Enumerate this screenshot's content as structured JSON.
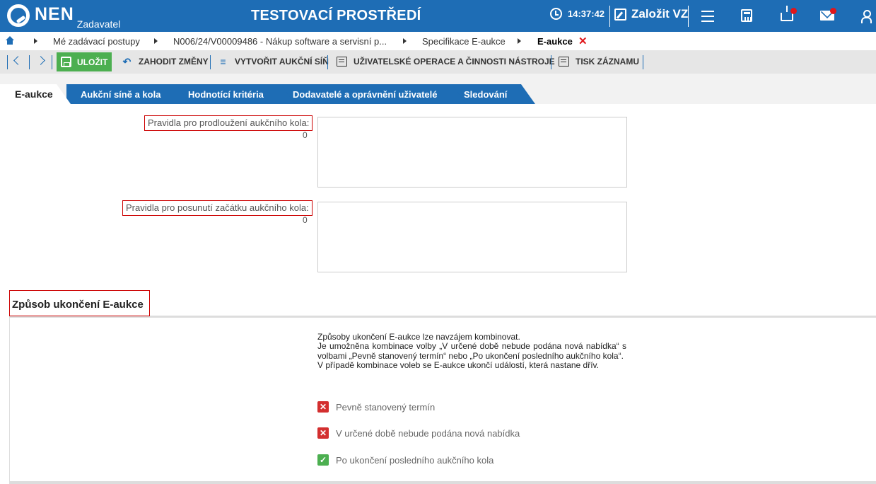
{
  "header": {
    "logo_text": "NEN",
    "logo_sub": "Zadavatel",
    "env_title": "TESTOVACÍ PROSTŘEDÍ",
    "time": "14:37:42",
    "create_label": "Založit VZ"
  },
  "breadcrumb": {
    "items": [
      "Mé zadávací postupy",
      "N006/24/V00009486 - Nákup software a servisní p...",
      "Specifikace E-aukce",
      "E-aukce"
    ]
  },
  "toolbar": {
    "save_label": "ULOŽIT",
    "discard_label": "ZAHODIT ZMĚNY",
    "create_hall_label": "VYTVOŘIT AUKČNÍ SÍŇ",
    "user_ops_label": "UŽIVATELSKÉ OPERACE A ČINNOSTI NÁSTROJE",
    "print_label": "TISK ZÁZNAMU"
  },
  "tabs": [
    "E-aukce",
    "Aukční síně a kola",
    "Hodnotící kritéria",
    "Dodavatelé a oprávnění uživatelé",
    "Sledování"
  ],
  "form": {
    "extension_rules": {
      "label": "Pravidla pro prodloužení aukčního kola:",
      "count": "0",
      "value": ""
    },
    "shift_rules": {
      "label": "Pravidla pro posunutí začátku aukčního kola:",
      "count": "0",
      "value": ""
    }
  },
  "section": {
    "title": "Způsob ukončení E-aukce",
    "info_lines": [
      "Způsoby ukončení E-aukce lze navzájem kombinovat.",
      "Je umožněna kombinace volby „V určené době nebude podána nová nabídka“ s volbami „Pevně stanovený termín“ nebo „Po ukončení posledního aukčního kola“.",
      "V případě kombinace voleb se E-aukce ukončí událostí, která nastane dřív."
    ],
    "options": [
      {
        "label": "Pevně stanovený termín",
        "checked": false
      },
      {
        "label": "V určené době nebude podána nová nabídka",
        "checked": false
      },
      {
        "label": "Po ukončení posledního aukčního kola",
        "checked": true
      }
    ]
  },
  "colors": {
    "brand": "#1e6db5",
    "accent_green": "#4caf50",
    "error_red": "#d32f2f"
  }
}
